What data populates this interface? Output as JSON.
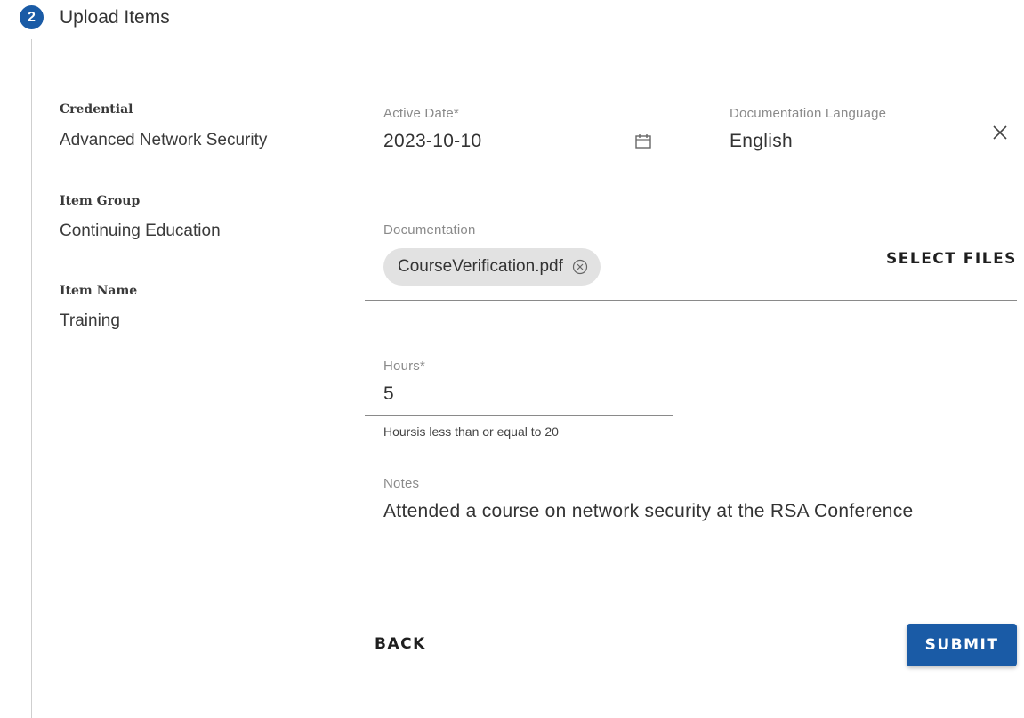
{
  "step": {
    "number": "2",
    "title": "Upload Items"
  },
  "summary": {
    "credential_label": "Credential",
    "credential_value": "Advanced Network Security",
    "group_label": "Item Group",
    "group_value": "Continuing Education",
    "name_label": "Item Name",
    "name_value": "Training"
  },
  "form": {
    "active_date": {
      "label": "Active Date*",
      "value": "2023-10-10",
      "icon": "calendar-icon"
    },
    "doc_language": {
      "label": "Documentation Language",
      "value": "English",
      "icon": "close-icon"
    },
    "documentation": {
      "label": "Documentation",
      "file_chip": "CourseVerification.pdf",
      "chip_icon": "remove-circle-icon",
      "select_files": "SELECT FILES"
    },
    "hours": {
      "label": "Hours*",
      "value": "5",
      "helper": "Hoursis less than or equal to 20"
    },
    "notes": {
      "label": "Notes",
      "value": "Attended a course on network security at the RSA Conference"
    }
  },
  "actions": {
    "back": "BACK",
    "submit": "SUBMIT"
  },
  "colors": {
    "accent": "#1a5ba6",
    "chip_bg": "#e2e2e2",
    "label_gray": "#8a8a8a"
  }
}
